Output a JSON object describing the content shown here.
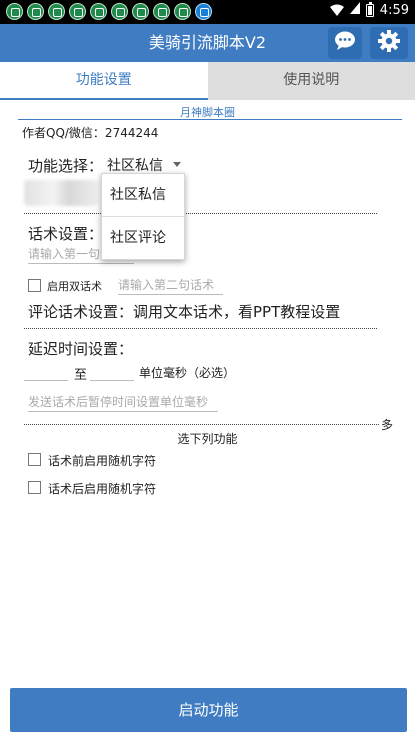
{
  "status_bar": {
    "app_icons": [
      "app-icon",
      "app-icon",
      "app-icon",
      "app-icon",
      "app-icon",
      "app-icon",
      "app-icon",
      "app-icon",
      "app-icon",
      "app-icon"
    ],
    "time": "4:59",
    "wifi_icon": "wifi-icon",
    "signal_icon": "signal-icon",
    "battery_icon": "battery-icon"
  },
  "app_bar": {
    "title": "美骑引流脚本V2",
    "chat_icon": "chat-bubble-icon",
    "settings_icon": "gear-icon",
    "color": "#3f7cc2"
  },
  "tabs": [
    {
      "label": "功能设置",
      "active": true
    },
    {
      "label": "使用说明",
      "active": false
    }
  ],
  "header": {
    "link_title": "月神脚本圈",
    "author": "作者QQ/微信：2744244"
  },
  "function_select": {
    "label": "功能选择：",
    "selected": "社区私信",
    "options": [
      "社区私信",
      "社区评论"
    ]
  },
  "script_settings": {
    "label": "话术设置：",
    "placeholder_first": "请输入第一句话术",
    "dual_label": "启用双话术",
    "placeholder_second": "请输入第二句话术"
  },
  "comment_settings": {
    "label": "评论话术设置：调用文本话术，看PPT教程设置"
  },
  "delay": {
    "label": "延迟时间设置：",
    "to_label": "至",
    "unit_label": "单位毫秒（必选）",
    "pause_placeholder": "发送话术后暂停时间设置单位毫秒"
  },
  "multi_select": {
    "suffix": "多",
    "label": "选下列功能",
    "options": [
      "话术前启用随机字符",
      "话术后启用随机字符"
    ]
  },
  "start_button": {
    "label": "启动功能"
  }
}
